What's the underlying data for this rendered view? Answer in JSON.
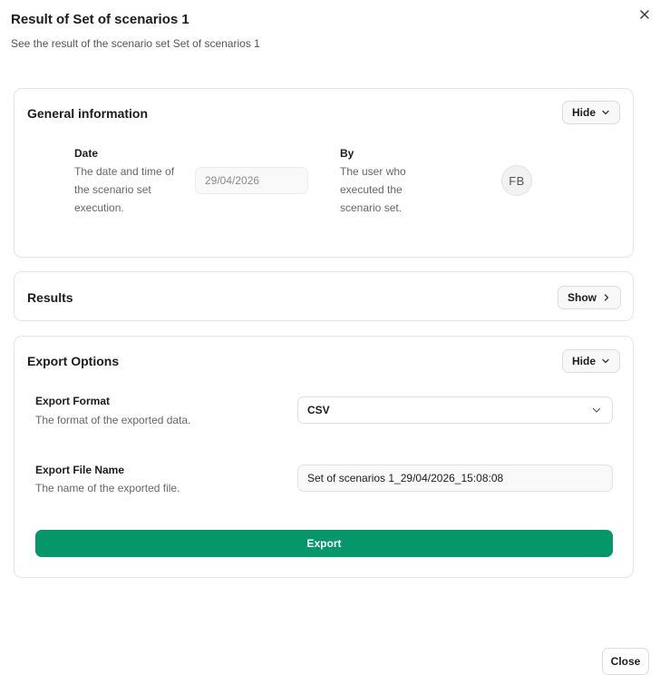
{
  "dialog": {
    "title": "Result of Set of scenarios 1",
    "subtitle": "See the result of the scenario set Set of scenarios 1",
    "close_button": "Close",
    "close_icon": "close-icon"
  },
  "general_info": {
    "title": "General information",
    "toggle_label": "Hide",
    "date": {
      "label": "Date",
      "description": "The date and time of the scenario set execution.",
      "value": "29/04/2026"
    },
    "by": {
      "label": "By",
      "description": "The user who executed the scenario set.",
      "avatar_initials": "FB"
    }
  },
  "results": {
    "title": "Results",
    "toggle_label": "Show"
  },
  "export_options": {
    "title": "Export Options",
    "toggle_label": "Hide",
    "format": {
      "label": "Export Format",
      "description": "The format of the exported data.",
      "selected": "CSV"
    },
    "file_name": {
      "label": "Export File Name",
      "description": "The name of the exported file.",
      "value": "Set of scenarios 1_29/04/2026_15:08:08"
    },
    "export_button": "Export"
  },
  "colors": {
    "accent": "#059669",
    "border": "#e4e4e4"
  }
}
